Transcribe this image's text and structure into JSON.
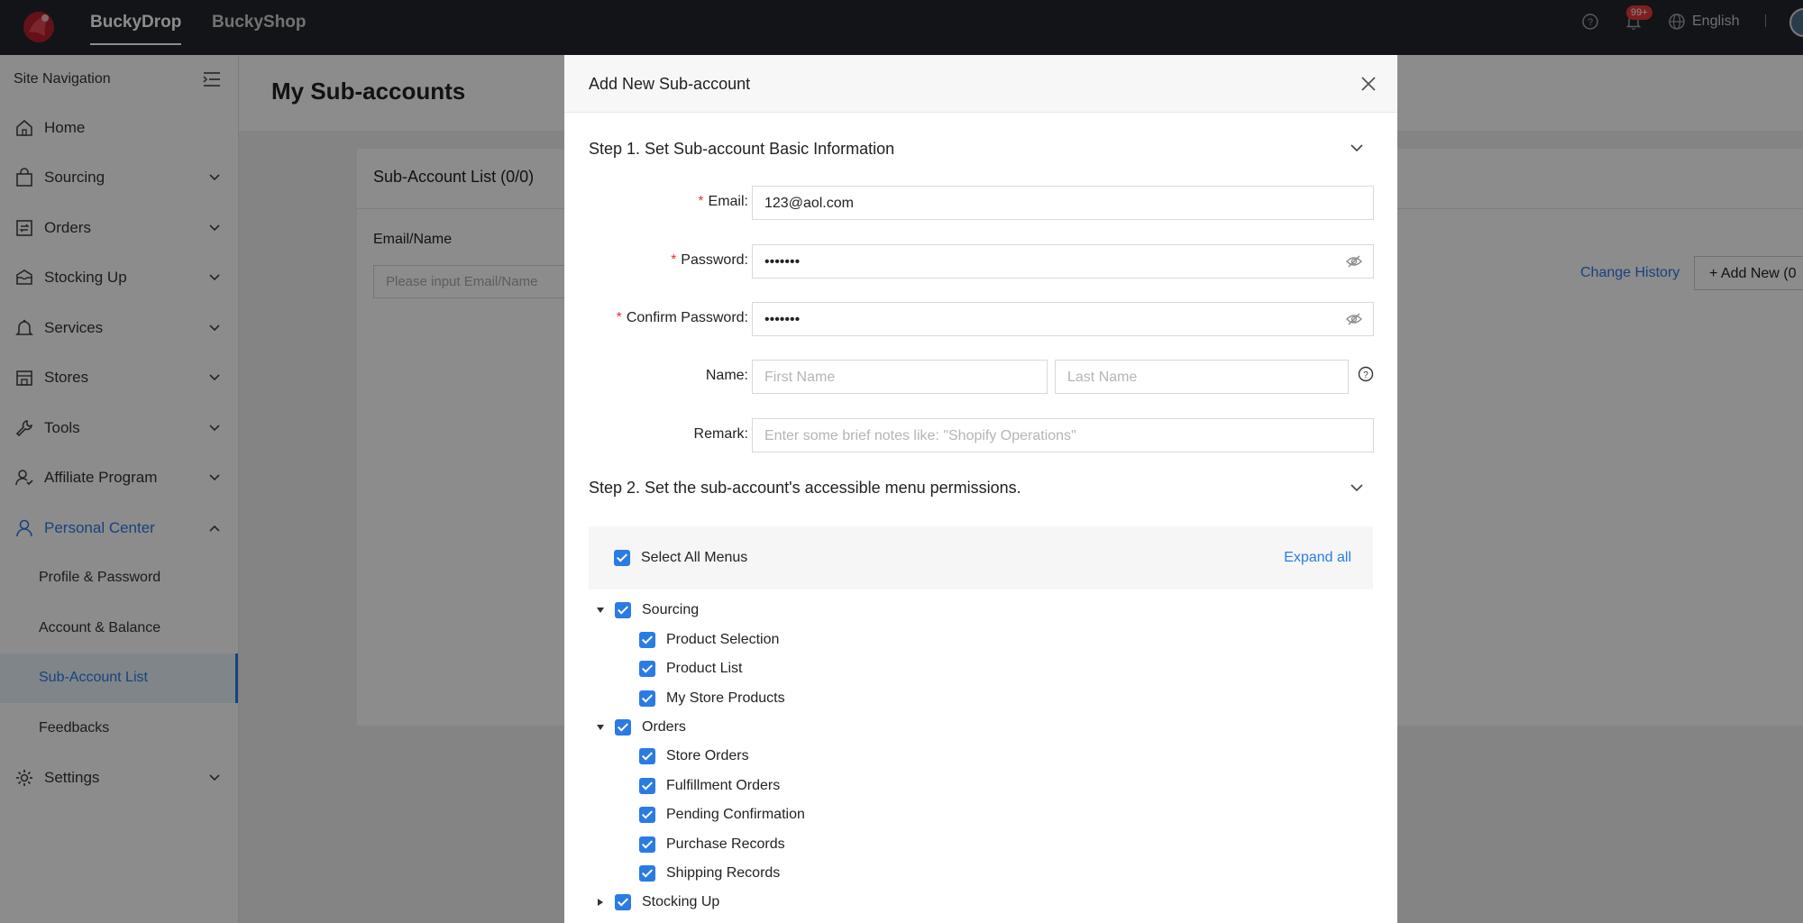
{
  "topbar": {
    "tabs": [
      {
        "label": "BuckyDrop"
      },
      {
        "label": "BuckyShop"
      }
    ],
    "notification_count": "99+",
    "language": "English"
  },
  "sidebar": {
    "header": "Site Navigation",
    "items": [
      {
        "label": "Home",
        "icon": "home-icon"
      },
      {
        "label": "Sourcing",
        "icon": "bag-icon"
      },
      {
        "label": "Orders",
        "icon": "orders-icon"
      },
      {
        "label": "Stocking Up",
        "icon": "box-icon"
      },
      {
        "label": "Services",
        "icon": "bell-icon"
      },
      {
        "label": "Stores",
        "icon": "store-icon"
      },
      {
        "label": "Tools",
        "icon": "wrench-icon"
      },
      {
        "label": "Affiliate Program",
        "icon": "affiliate-icon"
      },
      {
        "label": "Personal Center",
        "icon": "user-icon"
      },
      {
        "label": "Settings",
        "icon": "gear-icon"
      }
    ],
    "sub_items": [
      {
        "label": "Profile & Password"
      },
      {
        "label": "Account & Balance"
      },
      {
        "label": "Sub-Account List"
      },
      {
        "label": "Feedbacks"
      }
    ]
  },
  "page": {
    "title": "My Sub-accounts",
    "card_title": "Sub-Account List  (0/0)",
    "filter_label": "Email/Name",
    "filter_placeholder": "Please input Email/Name",
    "change_history": "Change History",
    "add_new": "+ Add New (0"
  },
  "modal": {
    "title": "Add New Sub-account",
    "step1": "Step 1. Set Sub-account Basic Information",
    "email_label": "Email",
    "email_value": "123@aol.com",
    "password_label": "Password",
    "password_value": "•••••••",
    "confirm_label": "Confirm Password",
    "confirm_value": "•••••••",
    "name_label": "Name",
    "first_name_placeholder": "First Name",
    "last_name_placeholder": "Last Name",
    "remark_label": "Remark",
    "remark_placeholder": "Enter some brief notes like: \"Shopify Operations\"",
    "step2": "Step 2. Set the sub-account's accessible menu permissions.",
    "select_all": "Select All Menus",
    "expand_all": "Expand all",
    "tree": [
      {
        "label": "Sourcing",
        "expanded": true,
        "children": [
          "Product Selection",
          "Product List",
          "My Store Products"
        ]
      },
      {
        "label": "Orders",
        "expanded": true,
        "children": [
          "Store Orders",
          "Fulfillment Orders",
          "Pending Confirmation",
          "Purchase Records",
          "Shipping Records"
        ]
      },
      {
        "label": "Stocking Up",
        "expanded": false,
        "children": []
      }
    ]
  },
  "colors": {
    "accent": "#2a7be4",
    "topbar": "#23262b",
    "required": "#e5393c"
  }
}
